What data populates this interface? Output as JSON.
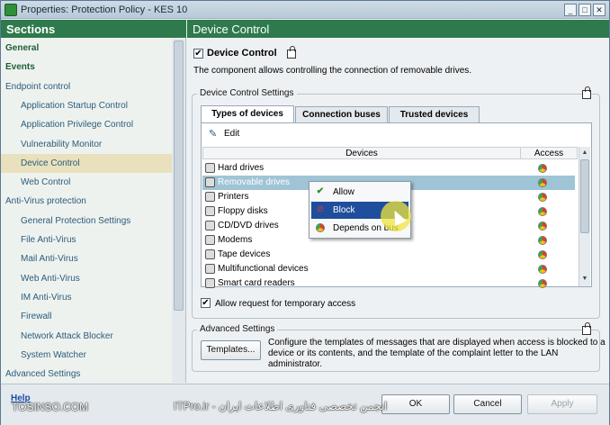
{
  "window": {
    "title": "Properties: Protection Policy - KES 10",
    "controls": {
      "minimize": "_",
      "maximize": "□",
      "close": "✕"
    }
  },
  "sidebar": {
    "header": "Sections",
    "items": [
      {
        "label": "General",
        "kind": "section"
      },
      {
        "label": "Events",
        "kind": "section"
      },
      {
        "label": "Endpoint control",
        "kind": "group"
      },
      {
        "label": "Application Startup Control",
        "kind": "child"
      },
      {
        "label": "Application Privilege Control",
        "kind": "child"
      },
      {
        "label": "Vulnerability Monitor",
        "kind": "child"
      },
      {
        "label": "Device Control",
        "kind": "child",
        "selected": true
      },
      {
        "label": "Web Control",
        "kind": "child"
      },
      {
        "label": "Anti-Virus protection",
        "kind": "group"
      },
      {
        "label": "General Protection Settings",
        "kind": "child"
      },
      {
        "label": "File Anti-Virus",
        "kind": "child"
      },
      {
        "label": "Mail Anti-Virus",
        "kind": "child"
      },
      {
        "label": "Web Anti-Virus",
        "kind": "child"
      },
      {
        "label": "IM Anti-Virus",
        "kind": "child"
      },
      {
        "label": "Firewall",
        "kind": "child"
      },
      {
        "label": "Network Attack Blocker",
        "kind": "child"
      },
      {
        "label": "System Watcher",
        "kind": "child"
      },
      {
        "label": "Advanced Settings",
        "kind": "group"
      }
    ]
  },
  "main": {
    "header": "Device Control",
    "enable_label": "Device Control",
    "enable_checked": "✔",
    "description": "The component allows controlling the connection of removable drives.",
    "settings_group": "Device Control Settings",
    "tabs": [
      "Types of devices",
      "Connection buses",
      "Trusted devices"
    ],
    "edit_label": "Edit",
    "columns": {
      "devices": "Devices",
      "access": "Access"
    },
    "devices": [
      {
        "label": "Hard drives"
      },
      {
        "label": "Removable drives",
        "highlighted": true
      },
      {
        "label": "Printers"
      },
      {
        "label": "Floppy disks"
      },
      {
        "label": "CD/DVD drives"
      },
      {
        "label": "Modems"
      },
      {
        "label": "Tape devices"
      },
      {
        "label": "Multifunctional devices"
      },
      {
        "label": "Smart card readers"
      }
    ],
    "temp_access_label": "Allow request for temporary access",
    "temp_access_checked": "✔",
    "context_menu": [
      {
        "label": "Allow",
        "icon": "check-icon"
      },
      {
        "label": "Block",
        "icon": "block-icon",
        "active": true
      },
      {
        "label": "Depends on bus",
        "icon": "depends-on-bus-icon"
      }
    ],
    "advanced_group": "Advanced Settings",
    "templates_button": "Templates...",
    "templates_text": [
      "Configure the templates of messages that are displayed when access is blocked to a",
      "device or its contents, and the template of the complaint letter to the LAN",
      "administrator."
    ]
  },
  "footer": {
    "help": "Help",
    "ok": "OK",
    "cancel": "Cancel",
    "apply": "Apply"
  },
  "watermark": {
    "left": "TOSINSO.COM",
    "right": "ITPro.ir - انجمن تخصصی فناوری اطلاعات ایران"
  },
  "colors": {
    "header_green": "#2e7a4c",
    "selected_nav": "#e9e1bd",
    "row_highlight": "#9fc4d6",
    "menu_active": "#1f4e9c"
  }
}
